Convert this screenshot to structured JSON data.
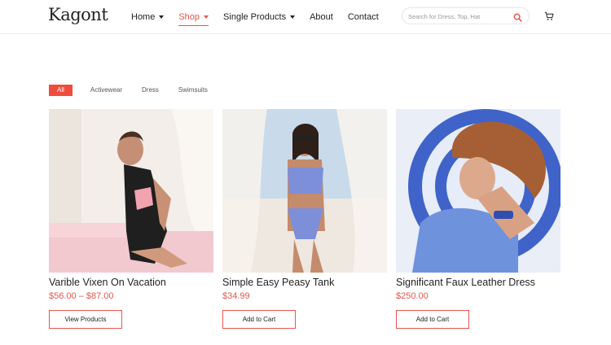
{
  "header": {
    "logo": "Kagont",
    "nav": [
      {
        "label": "Home",
        "dropdown": true,
        "active": false
      },
      {
        "label": "Shop",
        "dropdown": true,
        "active": true
      },
      {
        "label": "Single Products",
        "dropdown": true,
        "active": false
      },
      {
        "label": "About",
        "dropdown": false,
        "active": false
      },
      {
        "label": "Contact",
        "dropdown": false,
        "active": false
      }
    ],
    "search_placeholder": "Search for Dress, Top, Hat",
    "search_icon": "search-icon",
    "cart_icon": "cart-icon"
  },
  "filters": {
    "items": [
      "All",
      "Activewear",
      "Dress",
      "Swimsuits"
    ],
    "selected": "All"
  },
  "products": [
    {
      "name": "Varible Vixen On Vacation",
      "price": "$56.00 – $87.00",
      "button": "View Products"
    },
    {
      "name": "Simple Easy Peasy Tank",
      "price": "$34.99",
      "button": "Add to Cart"
    },
    {
      "name": "Significant Faux Leather Dress",
      "price": "$250.00",
      "button": "Add to Cart"
    }
  ],
  "colors": {
    "accent": "#e8554e",
    "filter_active": "#f04c3e"
  }
}
